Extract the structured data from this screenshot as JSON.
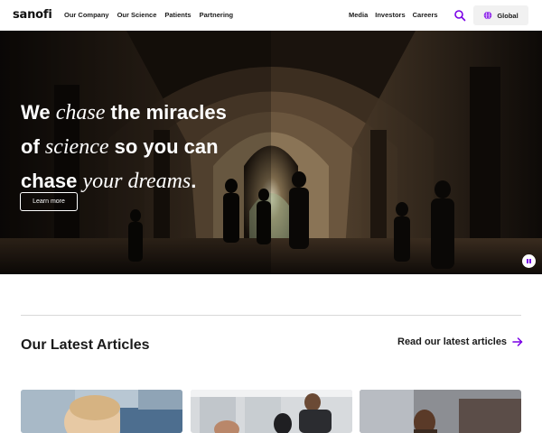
{
  "header": {
    "logo": "sanofi",
    "nav_left": [
      "Our Company",
      "Our Science",
      "Patients",
      "Partnering"
    ],
    "nav_right": [
      "Media",
      "Investors",
      "Careers"
    ],
    "global_label": "Global",
    "accent_color": "#7a00e6"
  },
  "hero": {
    "line1_a": "We ",
    "line1_em": "chase",
    "line1_b": " the miracles",
    "line2_a": "of ",
    "line2_em": "science",
    "line2_b": " so you can",
    "line3_a": "chase ",
    "line3_em": "your dreams",
    "line3_b": ".",
    "cta_label": "Learn more"
  },
  "articles": {
    "title": "Our Latest Articles",
    "read_more": "Read our latest articles"
  }
}
